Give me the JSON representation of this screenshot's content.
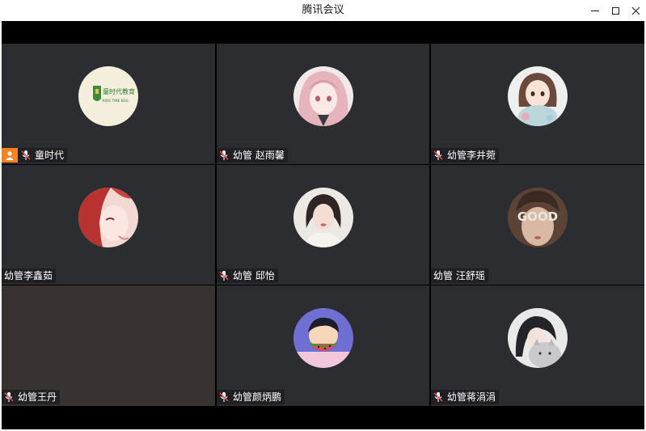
{
  "window": {
    "title": "腾讯会议"
  },
  "participants": [
    {
      "name": "童时代",
      "host": true,
      "mic_icon": "mic-off-icon",
      "avatar": "logo-avatar",
      "bg": "#2b2d31"
    },
    {
      "name": "幼管 赵雨馨",
      "host": false,
      "mic_icon": "mic-off-icon",
      "avatar": "anime-pink-hair-avatar",
      "bg": "#2b2d31"
    },
    {
      "name": "幼管李井菀",
      "host": false,
      "mic_icon": "mic-off-icon",
      "avatar": "cartoon-girl-avatar",
      "bg": "#2b2d31"
    },
    {
      "name": "幼管李鑫茹",
      "host": false,
      "mic_icon": null,
      "avatar": "anime-red-hair-avatar",
      "bg": "#2b2d31"
    },
    {
      "name": "幼管 邱怡",
      "host": false,
      "mic_icon": "mic-off-icon",
      "avatar": "portrait-woman-avatar",
      "bg": "#2b2d31"
    },
    {
      "name": "幼管 汪舒瑶",
      "host": false,
      "mic_icon": null,
      "avatar": "good-glasses-avatar",
      "bg": "#2b2d31"
    },
    {
      "name": "幼管王丹",
      "host": false,
      "mic_icon": "mic-off-icon",
      "avatar": null,
      "bg": "#383230"
    },
    {
      "name": "幼管颜炳鹏",
      "host": false,
      "mic_icon": "mic-off-icon",
      "avatar": "cartoon-watermelon-avatar",
      "bg": "#2b2d31"
    },
    {
      "name": "幼管蒋涓涓",
      "host": false,
      "mic_icon": "mic-off-icon",
      "avatar": "girl-with-cat-avatar",
      "bg": "#2b2d31"
    }
  ],
  "logo_text": {
    "top": "童时代教育",
    "bottom": "KIDS TIME EDU."
  },
  "good_text": "GOOD",
  "colors": {
    "tile": "#2b2d31",
    "host_badge": "#f5821f",
    "stage_bg": "#000000"
  }
}
